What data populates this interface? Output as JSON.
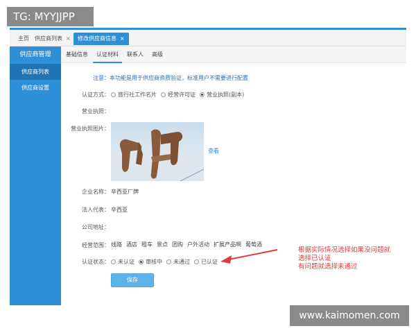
{
  "watermarks": {
    "top": "TG: MYYJJPP",
    "bottom": "www.kaimomen.com"
  },
  "tabs": [
    {
      "label": "主页",
      "closable": false
    },
    {
      "label": "供应商列表",
      "closable": true
    },
    {
      "label": "修改供应商信息",
      "closable": true,
      "active": true
    }
  ],
  "tab_close_glyph": "×",
  "sidebar": {
    "header": "供应商管理",
    "items": [
      {
        "label": "供应商列表",
        "active": true
      },
      {
        "label": "供应商设置",
        "active": false
      }
    ]
  },
  "subtabs": [
    {
      "label": "基础信息"
    },
    {
      "label": "认证材料",
      "active": true
    },
    {
      "label": "联系人"
    },
    {
      "label": "高级"
    }
  ],
  "form": {
    "notice": "注意：本功能是用于供应商资质验证，标准用户不需要进行配置",
    "auth_method_label": "认证方式：",
    "auth_methods": [
      {
        "label": "旅行社工作名片",
        "checked": false
      },
      {
        "label": "经营许可证",
        "checked": false
      },
      {
        "label": "营业执照(副本)",
        "checked": true
      }
    ],
    "license_label": "营业执照：",
    "license_image_label": "营业执照图片：",
    "view_link": "查看",
    "company_name_label": "企业名称：",
    "company_name": "辛西亚厂牌",
    "legal_rep_label": "法人代表：",
    "legal_rep": "辛西亚",
    "address_label": "公司地址：",
    "scope_label": "经营范围：",
    "scope_items": [
      "线路",
      "酒店",
      "租车",
      "景点",
      "团购",
      "户外活动",
      "扩展产品啊",
      "葡萄酒"
    ],
    "auth_status_label": "认证状态：",
    "auth_statuses": [
      {
        "label": "未认证",
        "checked": false
      },
      {
        "label": "审核中",
        "checked": true
      },
      {
        "label": "未通过",
        "checked": false
      },
      {
        "label": "已认证",
        "checked": false
      }
    ],
    "save_button": "保存"
  },
  "annotation": {
    "line1": "根据实际情况选择如果没问题就",
    "line2": "选择已认证",
    "line3": "有问题就选择未通过"
  },
  "colors": {
    "accent": "#2e8fd6",
    "annotation": "#e03c3c"
  }
}
